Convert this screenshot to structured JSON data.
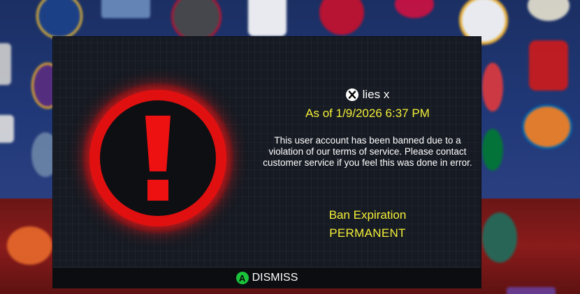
{
  "dialog": {
    "gamertag": "lies x",
    "as_of": "As of 1/9/2026 6:37 PM",
    "message": "This user account has been banned due to a violation of our terms of service. Please contact customer service if you feel this was done in error.",
    "ban_expiration_label": "Ban Expiration",
    "ban_expiration_value": "PERMANENT",
    "warning_icon": "exclamation-warning-icon",
    "platform_icon": "xbox-icon"
  },
  "footer": {
    "button_glyph": "A",
    "dismiss_label": "DISMISS"
  },
  "colors": {
    "accent_yellow": "#f4f038",
    "warning_red": "#e01010",
    "a_button_green": "#19c43a",
    "modal_bg": "#161a22"
  }
}
